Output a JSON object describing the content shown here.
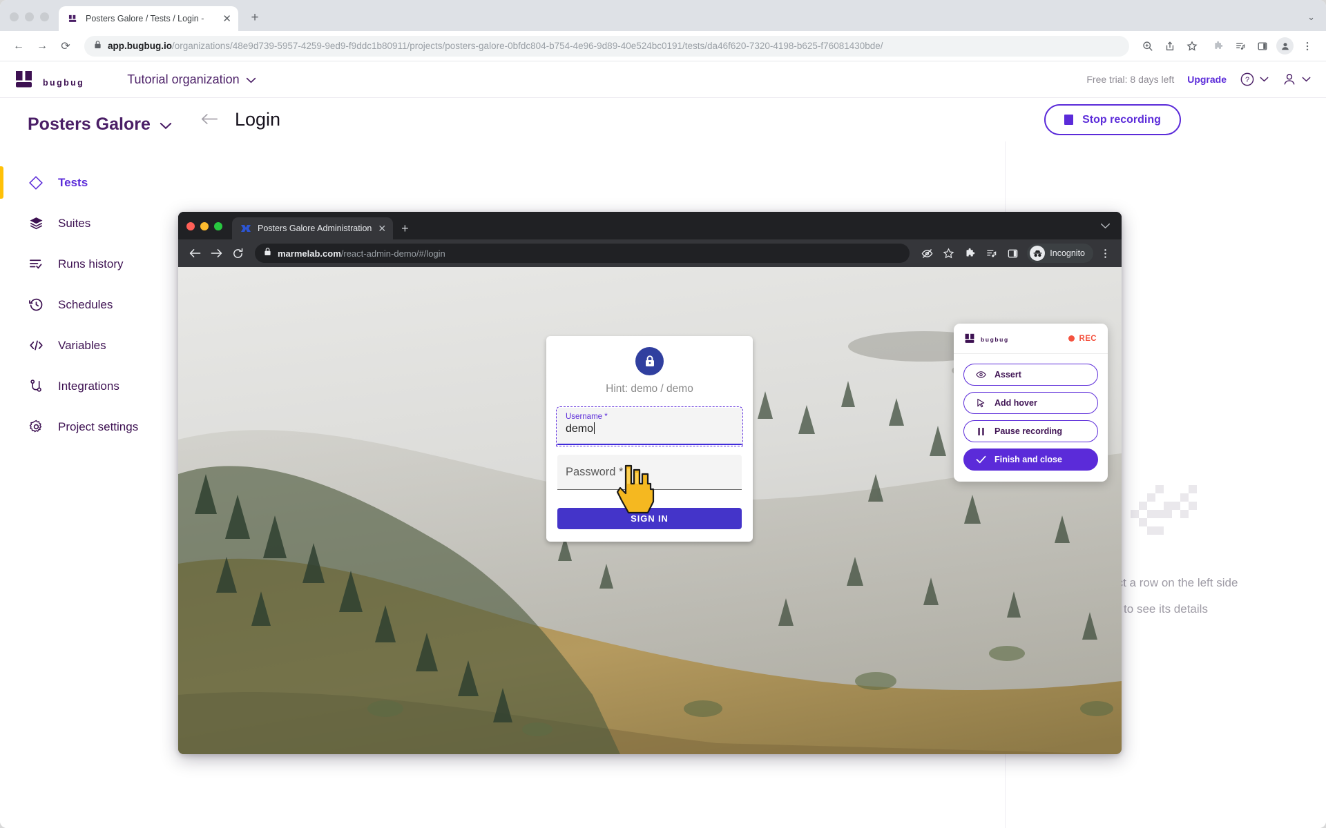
{
  "browser": {
    "tab": {
      "title": "Posters Galore / Tests / Login -",
      "close": "✕",
      "favicon_name": "bugbug-favicon"
    },
    "new_tab": "+",
    "url_bold": "app.bugbug.io",
    "url_rest": "/organizations/48e9d739-5957-4259-9ed9-f9ddc1b80911/projects/posters-galore-0bfdc804-b754-4e96-9d89-40e524bc0191/tests/da46f620-7320-4198-b625-f76081430bde/",
    "nav": {
      "back": "←",
      "forward": "→",
      "reload": "⟳"
    },
    "toolbar_icons": [
      "zoom-icon",
      "share-icon",
      "bookmark-star-icon",
      "extensions-puzzle-icon",
      "reading-list-icon",
      "side-panel-icon",
      "profile-avatar",
      "chrome-menu-icon"
    ]
  },
  "app_header": {
    "logo_word": "bugbug",
    "organization": "Tutorial organization",
    "trial_text": "Free trial: 8 days left",
    "upgrade_label": "Upgrade"
  },
  "sidebar": {
    "project": "Posters Galore",
    "items": [
      {
        "label": "Tests",
        "icon": "diamond-icon",
        "active": true
      },
      {
        "label": "Suites",
        "icon": "layers-icon",
        "active": false
      },
      {
        "label": "Runs history",
        "icon": "list-check-icon",
        "active": false
      },
      {
        "label": "Schedules",
        "icon": "clock-history-icon",
        "active": false
      },
      {
        "label": "Variables",
        "icon": "code-brackets-icon",
        "active": false
      },
      {
        "label": "Integrations",
        "icon": "node-link-icon",
        "active": false
      },
      {
        "label": "Project settings",
        "icon": "gear-icon",
        "active": false
      }
    ]
  },
  "content": {
    "page_title": "Login",
    "stop_recording_label": "Stop recording",
    "empty_state_line1": "Select a row on the left side",
    "empty_state_line2": "to see its details"
  },
  "inner_browser": {
    "tab_title": "Posters Galore Administration",
    "tab_close": "✕",
    "new_tab": "+",
    "url_bold": "marmelab.com",
    "url_rest": "/react-admin-demo/#/login",
    "incognito_label": "Incognito",
    "toolbar_icons": [
      "eye-off-icon",
      "bookmark-star-icon",
      "extensions-puzzle-icon",
      "reading-list-icon",
      "side-panel-icon",
      "incognito-icon",
      "chrome-menu-icon"
    ]
  },
  "login_card": {
    "hint": "Hint: demo / demo",
    "username_label": "Username *",
    "username_value": "demo",
    "password_placeholder": "Password *",
    "signin_label": "SIGN IN",
    "lock_icon_color": "#303f9f",
    "signin_color": "#4434c9"
  },
  "rec_widget": {
    "logo_word": "bugbug",
    "rec_label": "REC",
    "rec_color": "#f4523f",
    "buttons": [
      {
        "label": "Assert",
        "icon": "eye-icon",
        "primary": false
      },
      {
        "label": "Add hover",
        "icon": "cursor-arrow-icon",
        "primary": false
      },
      {
        "label": "Pause recording",
        "icon": "pause-icon",
        "primary": false
      },
      {
        "label": "Finish and close",
        "icon": "check-icon",
        "primary": true
      }
    ]
  },
  "theme": {
    "purple": "#5b2bd9",
    "deep_purple": "#3d1152",
    "accent_yellow": "#ffc107"
  }
}
